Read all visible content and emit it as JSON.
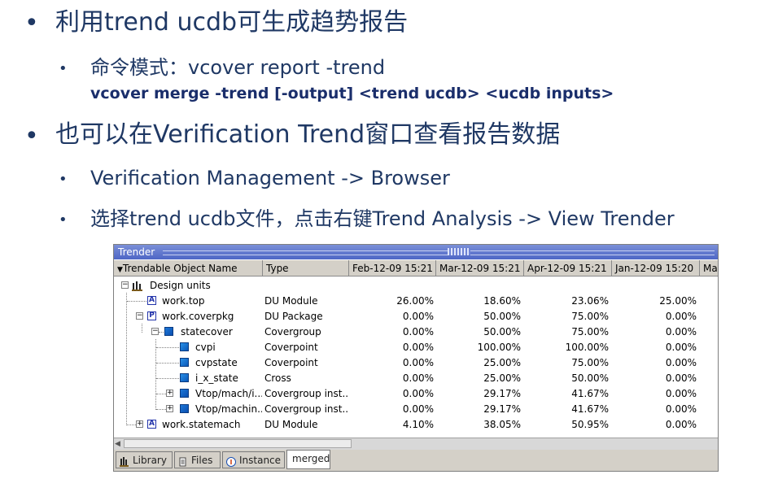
{
  "slide": {
    "bullet1": "利用trend ucdb可生成趋势报告",
    "sub1": "命令模式：vcover report -trend",
    "sub1_cmd": "vcover merge -trend [-output] <trend ucdb> <ucdb inputs>",
    "bullet2": "也可以在Verification Trend窗口查看报告数据",
    "sub2": "Verification Management -> Browser",
    "sub3": "选择trend ucdb文件，点击右键Trend Analysis -> View Trender"
  },
  "window": {
    "title": "Trender",
    "columns": [
      "Trendable Object Name",
      "Type",
      "Feb-12-09 15:21",
      "Mar-12-09 15:21",
      "Apr-12-09 15:21",
      "Jan-12-09 15:20",
      "Ma"
    ],
    "rows": [
      {
        "name": "Design units",
        "type": "",
        "v": [
          "",
          "",
          "",
          ""
        ]
      },
      {
        "name": "work.top",
        "type": "DU Module",
        "v": [
          "26.00%",
          "18.60%",
          "23.06%",
          "25.00%"
        ]
      },
      {
        "name": "work.coverpkg",
        "type": "DU Package",
        "v": [
          "0.00%",
          "50.00%",
          "75.00%",
          "0.00%"
        ]
      },
      {
        "name": "statecover",
        "type": "Covergroup",
        "v": [
          "0.00%",
          "50.00%",
          "75.00%",
          "0.00%"
        ]
      },
      {
        "name": "cvpi",
        "type": "Coverpoint",
        "v": [
          "0.00%",
          "100.00%",
          "100.00%",
          "0.00%"
        ]
      },
      {
        "name": "cvpstate",
        "type": "Coverpoint",
        "v": [
          "0.00%",
          "25.00%",
          "75.00%",
          "0.00%"
        ]
      },
      {
        "name": "i_x_state",
        "type": "Cross",
        "v": [
          "0.00%",
          "25.00%",
          "50.00%",
          "0.00%"
        ]
      },
      {
        "name": "Vtop/mach/i...",
        "type": "Covergroup inst...",
        "v": [
          "0.00%",
          "29.17%",
          "41.67%",
          "0.00%"
        ]
      },
      {
        "name": "Vtop/machin...",
        "type": "Covergroup inst...",
        "v": [
          "0.00%",
          "29.17%",
          "41.67%",
          "0.00%"
        ]
      },
      {
        "name": "work.statemach",
        "type": "DU Module",
        "v": [
          "4.10%",
          "38.05%",
          "50.95%",
          "0.00%"
        ]
      }
    ],
    "tabs": [
      "Library",
      "Files",
      "Instance",
      "merged"
    ]
  }
}
